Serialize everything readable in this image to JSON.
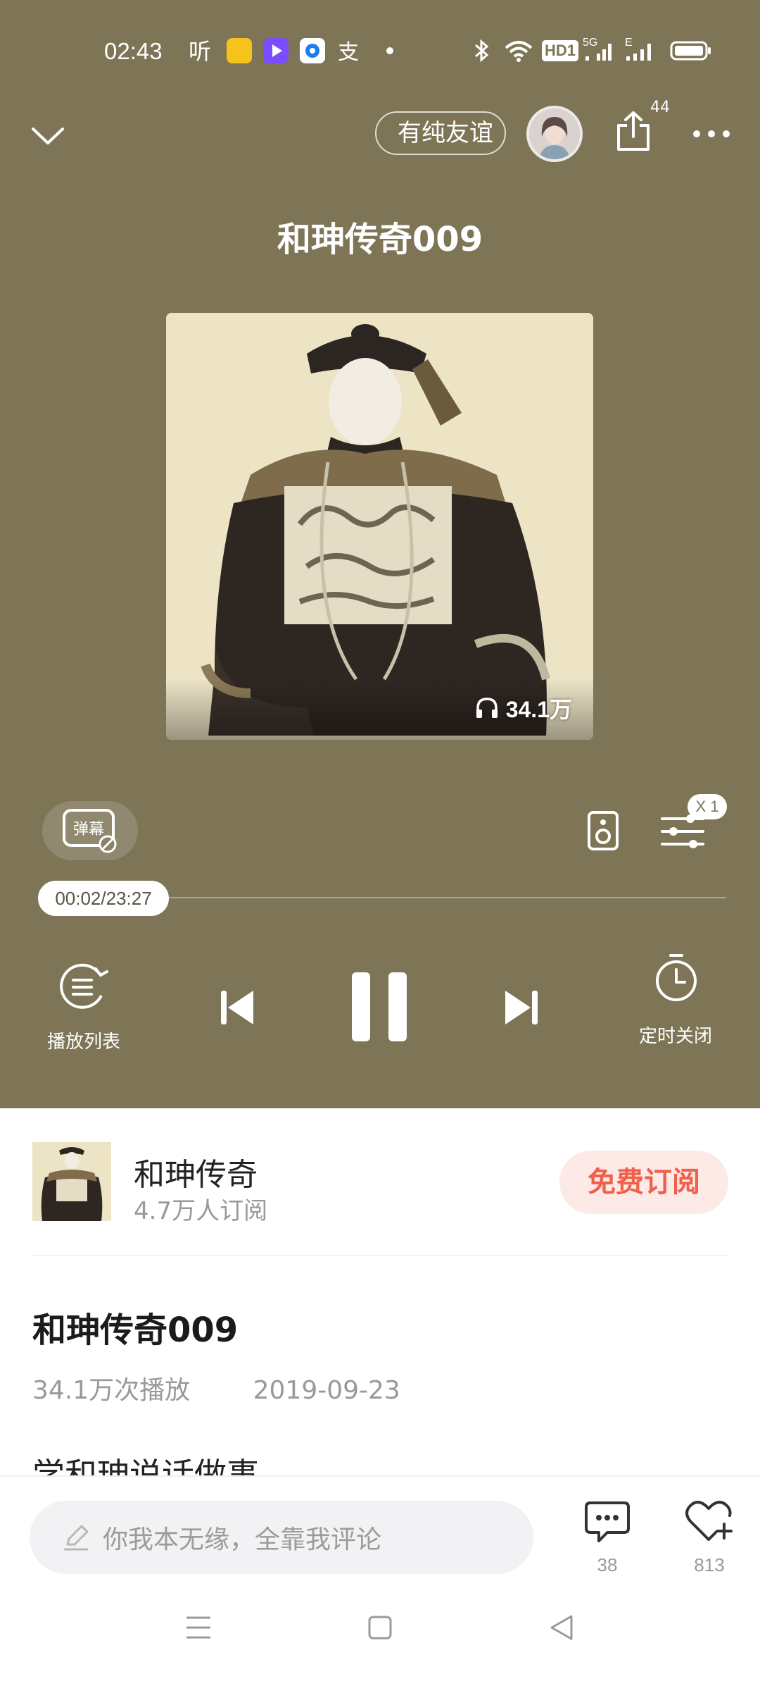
{
  "status_bar": {
    "time": "02:43",
    "icons": [
      "ting-icon",
      "yellow-app-icon",
      "video-app-icon",
      "browser-app-icon",
      "alipay-icon",
      "dot-icon",
      "bluetooth-icon",
      "wifi-icon",
      "hd-icon",
      "signal-5g-icon",
      "signal-e-icon",
      "battery-icon"
    ],
    "hd_label": "HD1",
    "net_5g": "5G",
    "net_e": "E"
  },
  "top_bar": {
    "friend_pill_text": "有纯友谊",
    "share_count": "44"
  },
  "episode": {
    "title": "和珅传奇009",
    "play_count": "34.1万"
  },
  "controls": {
    "danmu_label": "弹幕",
    "speed": "X 1",
    "progress_time": "00:02/23:27",
    "playlist_label": "播放列表",
    "timer_label": "定时关闭",
    "progress_fraction": 0.0015
  },
  "album": {
    "name": "和珅传奇",
    "subscribers": "4.7万人订阅",
    "subscribe_label": "免费订阅"
  },
  "detail": {
    "title": "和珅传奇009",
    "plays": "34.1万次播放",
    "date": "2019-09-23",
    "desc": "学和珅说话做事"
  },
  "bottom_bar": {
    "comment_placeholder": "你我本无缘，全靠我评论",
    "comment_count": "38",
    "like_count": "813"
  },
  "colors": {
    "player_bg": "#7d7556",
    "accent": "#f0604a"
  }
}
